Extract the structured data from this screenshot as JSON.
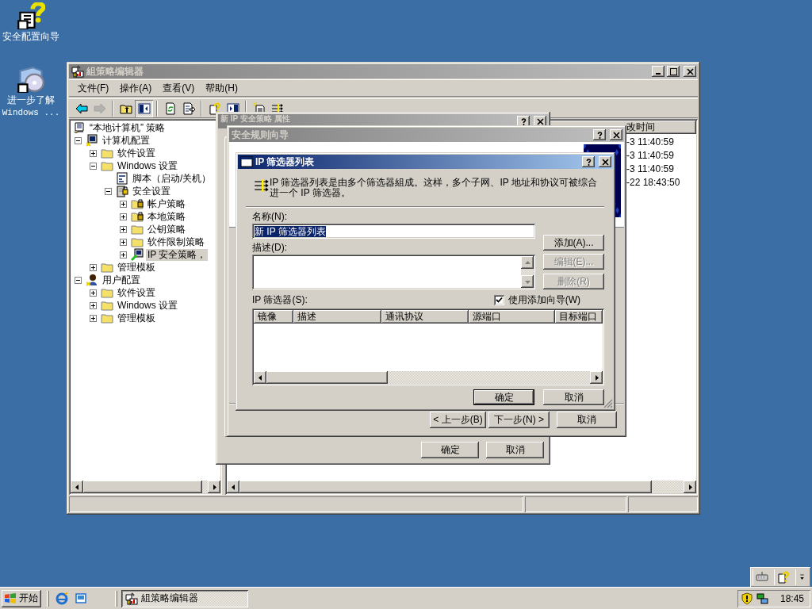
{
  "desktop_icons": [
    {
      "kind": "wizard",
      "lines": [
        "安全配置向导"
      ]
    },
    {
      "kind": "cd",
      "lines": [
        "进一步了解",
        "Windows ..."
      ]
    }
  ],
  "main_window": {
    "title": "組策略编辑器",
    "active": false,
    "menu": [
      "文件(F)",
      "操作(A)",
      "查看(V)",
      "帮助(H)"
    ],
    "toolbar": [
      [
        {
          "kind": "back",
          "disabled": false,
          "pressed": false
        },
        {
          "kind": "forward",
          "disabled": true,
          "pressed": false
        }
      ],
      [
        {
          "kind": "up",
          "disabled": false,
          "pressed": false
        },
        {
          "kind": "tree",
          "disabled": false,
          "pressed": true
        }
      ],
      [
        {
          "kind": "refresh",
          "disabled": false,
          "pressed": false
        },
        {
          "kind": "export",
          "disabled": false,
          "pressed": false
        }
      ],
      [
        {
          "kind": "help",
          "disabled": false,
          "pressed": false
        },
        {
          "kind": "panel",
          "disabled": false,
          "pressed": false
        }
      ],
      [
        {
          "kind": "newdoc",
          "disabled": false,
          "pressed": false
        },
        {
          "kind": "filter",
          "disabled": false,
          "pressed": false
        }
      ]
    ],
    "tree": [
      {
        "label": "“本地计算机” 策略",
        "kind": "policy",
        "toggle": false,
        "expanded": true,
        "selected": false,
        "children": [
          {
            "label": "计算机配置",
            "kind": "computer",
            "toggle": true,
            "expanded": true,
            "selected": false,
            "children": [
              {
                "label": "软件设置",
                "kind": "folder",
                "toggle": true,
                "expanded": false,
                "selected": false
              },
              {
                "label": "Windows 设置",
                "kind": "folder",
                "toggle": true,
                "expanded": true,
                "selected": false,
                "children": [
                  {
                    "label": "脚本（启动/关机）",
                    "kind": "script",
                    "toggle": false,
                    "expanded": false,
                    "selected": false
                  },
                  {
                    "label": "安全设置",
                    "kind": "security",
                    "toggle": true,
                    "expanded": true,
                    "selected": false,
                    "children": [
                      {
                        "label": "帐户策略",
                        "kind": "lockfolder",
                        "toggle": true,
                        "expanded": false,
                        "selected": false
                      },
                      {
                        "label": "本地策略",
                        "kind": "lockfolder",
                        "toggle": true,
                        "expanded": false,
                        "selected": false
                      },
                      {
                        "label": "公钥策略",
                        "kind": "folder",
                        "toggle": true,
                        "expanded": false,
                        "selected": false
                      },
                      {
                        "label": "软件限制策略",
                        "kind": "folder",
                        "toggle": true,
                        "expanded": false,
                        "selected": false
                      },
                      {
                        "label": "IP 安全策略，",
                        "kind": "ipsec",
                        "toggle": true,
                        "expanded": false,
                        "selected": true
                      }
                    ]
                  }
                ]
              },
              {
                "label": "管理模板",
                "kind": "folder",
                "toggle": true,
                "expanded": false,
                "selected": false
              }
            ]
          },
          {
            "label": "用户配置",
            "kind": "user",
            "toggle": true,
            "expanded": true,
            "selected": false,
            "children": [
              {
                "label": "软件设置",
                "kind": "folder",
                "toggle": true,
                "expanded": false,
                "selected": false
              },
              {
                "label": "Windows 设置",
                "kind": "folder",
                "toggle": true,
                "expanded": false,
                "selected": false
              },
              {
                "label": "管理模板",
                "kind": "folder",
                "toggle": true,
                "expanded": false,
                "selected": false
              }
            ]
          }
        ]
      }
    ],
    "list": {
      "columns": [
        "改时间"
      ],
      "rows": [
        [
          "-3 11:40:59"
        ],
        [
          "-3 11:40:59"
        ],
        [
          "-3 11:40:59"
        ],
        [
          "-22 18:43:50"
        ]
      ]
    }
  },
  "properties_dialog": {
    "title": "新 IP 安全策略 属性",
    "active": false,
    "buttons": [
      "确定",
      "取消"
    ]
  },
  "wizard_dialog": {
    "title": "安全规则向导",
    "active": false,
    "buttons": [
      "< 上一步(B)",
      "下一步(N) >",
      "取消"
    ]
  },
  "filter_list_dialog": {
    "title": "IP 筛选器列表",
    "active": true,
    "intro": "IP 筛选器列表是由多个筛选器組成。这样，多个子网、IP 地址和协议可被综合进一个 IP 筛选器。",
    "name_label": "名称(N):",
    "name_value": "新 IP 筛选器列表",
    "name_selected": true,
    "description_label": "描述(D):",
    "side_buttons": [
      {
        "label": "添加(A)...",
        "disabled": false
      },
      {
        "label": "编辑(E)...",
        "disabled": true
      },
      {
        "label": "删除(R)",
        "disabled": true
      }
    ],
    "filters_label": "IP 筛选器(S):",
    "wizard_checkbox": {
      "label": "使用添加向导(W)",
      "checked": true
    },
    "columns": [
      "镜像",
      "描述",
      "通讯协议",
      "源端口",
      "目标端口"
    ],
    "buttons": [
      {
        "label": "确定",
        "default": true
      },
      {
        "label": "取消",
        "default": false
      }
    ]
  },
  "language_bar": [
    {
      "kind": "keyboard"
    },
    {
      "kind": "help"
    },
    {
      "kind": "options"
    }
  ],
  "taskbar": {
    "start": "开始",
    "quick_launch": [
      {
        "kind": "browser"
      },
      {
        "kind": "desktop"
      }
    ],
    "tasks": [
      {
        "label": "組策略编辑器",
        "selected": true
      }
    ],
    "tray": [
      {
        "kind": "shield"
      },
      {
        "kind": "network"
      }
    ],
    "clock": "18:45"
  }
}
